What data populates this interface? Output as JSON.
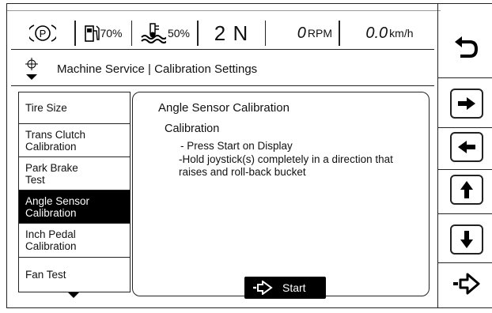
{
  "status": {
    "park_symbol": "P",
    "fuel_pct": "70%",
    "coolant_pct": "50%",
    "gear": "2 N",
    "rpm_value": "0",
    "rpm_unit": "RPM",
    "speed_value": "0.0",
    "speed_unit": "km/h"
  },
  "breadcrumb": {
    "text": "Machine Service | Calibration Settings"
  },
  "menu": {
    "items": [
      {
        "label": "Tire Size",
        "selected": false
      },
      {
        "label": "Trans Clutch Calibration",
        "selected": false
      },
      {
        "label": "Park Brake Test",
        "selected": false
      },
      {
        "label": "Angle Sensor Calibration",
        "selected": true
      },
      {
        "label": "Inch Pedal Calibration",
        "selected": false
      },
      {
        "label": "Fan Test",
        "selected": false
      }
    ]
  },
  "content": {
    "title": "Angle Sensor Calibration",
    "subtitle": "Calibration",
    "steps": [
      "- Press Start on Display",
      "-Hold joystick(s) completely in a direction that raises and roll-back bucket"
    ],
    "start_label": "Start"
  },
  "sidebar": {
    "buttons": [
      "back-icon",
      "arrow-right-icon",
      "arrow-left-icon",
      "arrow-up-icon",
      "arrow-down-icon",
      "enter-icon"
    ]
  }
}
